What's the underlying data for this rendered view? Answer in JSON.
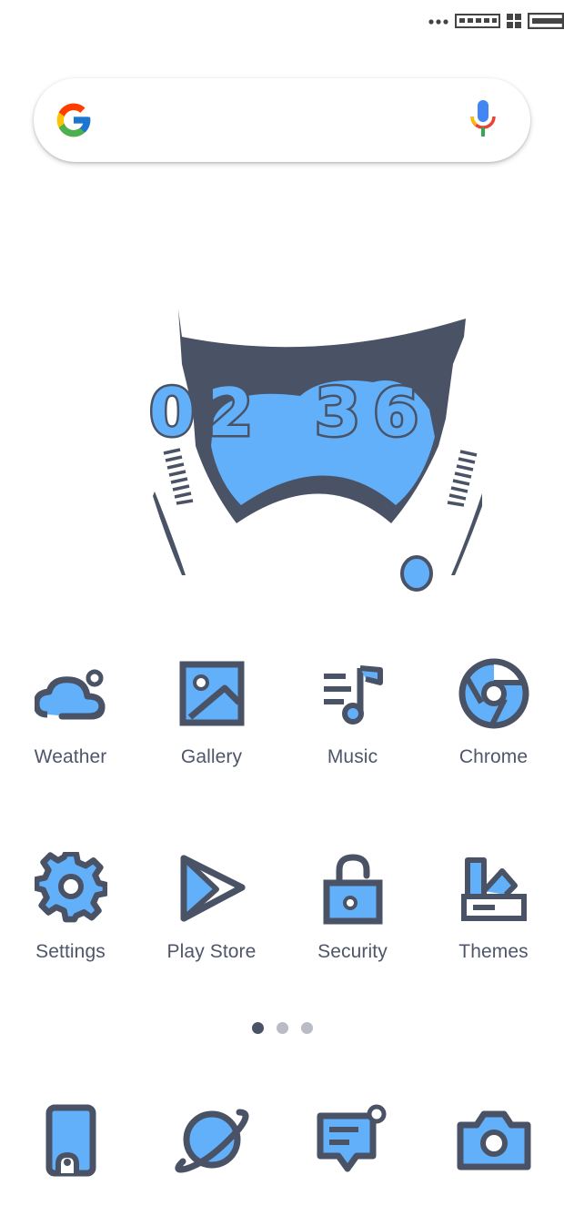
{
  "status_bar": {
    "icons": [
      "more-dots-icon",
      "signal-icon",
      "network-icon",
      "battery-icon"
    ]
  },
  "search_bar": {
    "logo": "google-g-icon",
    "mic": "mic-icon"
  },
  "clock": {
    "hour": "02",
    "minute": "36"
  },
  "apps": [
    {
      "label": "Weather",
      "icon": "weather-icon"
    },
    {
      "label": "Gallery",
      "icon": "gallery-icon"
    },
    {
      "label": "Music",
      "icon": "music-icon"
    },
    {
      "label": "Chrome",
      "icon": "chrome-icon"
    },
    {
      "label": "Settings",
      "icon": "gear-icon"
    },
    {
      "label": "Play Store",
      "icon": "play-store-icon"
    },
    {
      "label": "Security",
      "icon": "lock-icon"
    },
    {
      "label": "Themes",
      "icon": "themes-icon"
    }
  ],
  "page_indicator": {
    "count": 3,
    "active": 0
  },
  "dock": [
    {
      "icon": "phone-icon"
    },
    {
      "icon": "browser-planet-icon"
    },
    {
      "icon": "messages-icon"
    },
    {
      "icon": "camera-icon"
    }
  ],
  "colors": {
    "accent": "#62b0fa",
    "outline": "#4a5266",
    "background": "#ffffff"
  }
}
